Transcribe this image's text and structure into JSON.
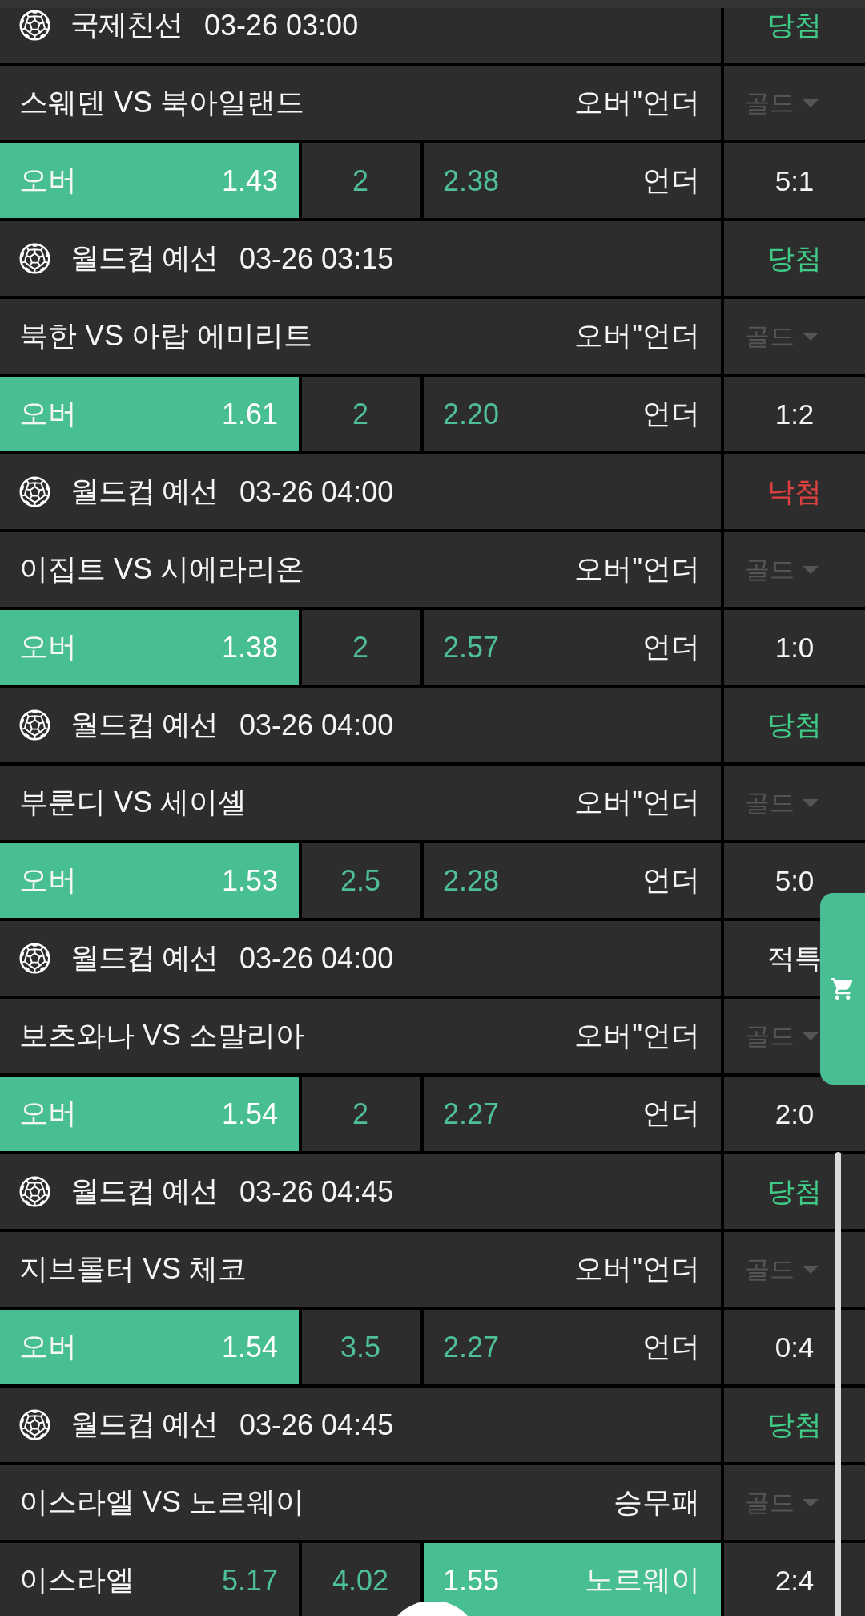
{
  "matches": [
    {
      "league": "국제친선",
      "time": "03-26 03:00",
      "result": {
        "text": "당첨",
        "kind": "win"
      },
      "teams": "스웨덴 VS 북아일랜드",
      "market": "오버\"언더",
      "grade": {
        "label": "골드",
        "disabled": true
      },
      "home": {
        "label": "오버",
        "odds": "1.43",
        "selected": true
      },
      "middle": {
        "value": "2",
        "selected": false
      },
      "away": {
        "odds": "2.38",
        "label": "언더",
        "selected": false
      },
      "score": "5:1"
    },
    {
      "league": "월드컵 예선",
      "time": "03-26 03:15",
      "result": {
        "text": "당첨",
        "kind": "win"
      },
      "teams": "북한 VS 아랍 에미리트",
      "market": "오버\"언더",
      "grade": {
        "label": "골드",
        "disabled": true
      },
      "home": {
        "label": "오버",
        "odds": "1.61",
        "selected": true
      },
      "middle": {
        "value": "2",
        "selected": false
      },
      "away": {
        "odds": "2.20",
        "label": "언더",
        "selected": false
      },
      "score": "1:2"
    },
    {
      "league": "월드컵 예선",
      "time": "03-26 04:00",
      "result": {
        "text": "낙첨",
        "kind": "lose"
      },
      "teams": "이집트 VS 시에라리온",
      "market": "오버\"언더",
      "grade": {
        "label": "골드",
        "disabled": true
      },
      "home": {
        "label": "오버",
        "odds": "1.38",
        "selected": true
      },
      "middle": {
        "value": "2",
        "selected": false
      },
      "away": {
        "odds": "2.57",
        "label": "언더",
        "selected": false
      },
      "score": "1:0"
    },
    {
      "league": "월드컵 예선",
      "time": "03-26 04:00",
      "result": {
        "text": "당첨",
        "kind": "win"
      },
      "teams": "부룬디 VS 세이셸",
      "market": "오버\"언더",
      "grade": {
        "label": "골드",
        "disabled": true
      },
      "home": {
        "label": "오버",
        "odds": "1.53",
        "selected": true
      },
      "middle": {
        "value": "2.5",
        "selected": false
      },
      "away": {
        "odds": "2.28",
        "label": "언더",
        "selected": false
      },
      "score": "5:0"
    },
    {
      "league": "월드컵 예선",
      "time": "03-26 04:00",
      "result": {
        "text": "적특",
        "kind": "void"
      },
      "teams": "보츠와나 VS 소말리아",
      "market": "오버\"언더",
      "grade": {
        "label": "골드",
        "disabled": true
      },
      "home": {
        "label": "오버",
        "odds": "1.54",
        "selected": true
      },
      "middle": {
        "value": "2",
        "selected": false
      },
      "away": {
        "odds": "2.27",
        "label": "언더",
        "selected": false
      },
      "score": "2:0"
    },
    {
      "league": "월드컵 예선",
      "time": "03-26 04:45",
      "result": {
        "text": "당첨",
        "kind": "win"
      },
      "teams": "지브롤터 VS 체코",
      "market": "오버\"언더",
      "grade": {
        "label": "골드",
        "disabled": true
      },
      "home": {
        "label": "오버",
        "odds": "1.54",
        "selected": true
      },
      "middle": {
        "value": "3.5",
        "selected": false
      },
      "away": {
        "odds": "2.27",
        "label": "언더",
        "selected": false
      },
      "score": "0:4"
    },
    {
      "league": "월드컵 예선",
      "time": "03-26 04:45",
      "result": {
        "text": "당첨",
        "kind": "win"
      },
      "teams": "이스라엘 VS 노르웨이",
      "market": "승무패",
      "grade": {
        "label": "골드",
        "disabled": true
      },
      "home": {
        "label": "이스라엘",
        "odds": "5.17",
        "selected": false
      },
      "middle": {
        "value": "4.02",
        "selected": false
      },
      "away": {
        "odds": "1.55",
        "label": "노르웨이",
        "selected": true
      },
      "score": "2:4"
    }
  ]
}
